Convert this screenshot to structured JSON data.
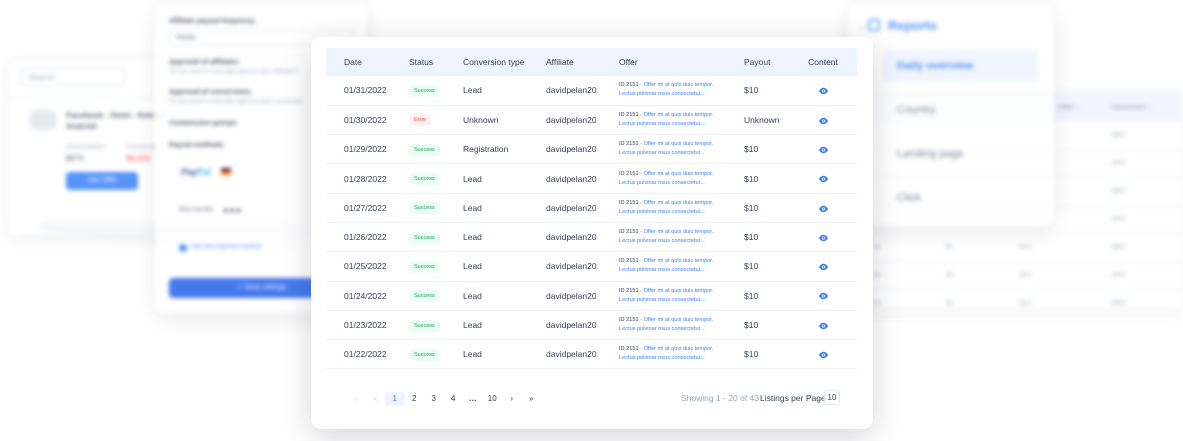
{
  "background": {
    "left_panel": {
      "search_placeholder": "Search",
      "item_title": "Facebook - Hotel - Keto at Android",
      "label_1": "Commission",
      "value_1": "$975",
      "label_2": "Conversion",
      "value_2": "$8,000",
      "button_label": "Join Offer"
    },
    "settings": {
      "payout_frequency_label": "Affiliate payout frequency",
      "payout_frequency_value": "Weekly",
      "approval_affiliates_label": "Approval of affiliates",
      "approval_affiliates_sub": "Do you want to manually approve new affiliates?",
      "approval_conversions_label": "Approval of conversions",
      "approval_conversions_sub": "Do you want to manually approve each conversion",
      "commission_groups_label": "Commission groups",
      "payout_methods_label": "Payout methods",
      "paypal_label_1": "Pay",
      "paypal_label_2": "Pal",
      "wire_label": "Wire transfer",
      "wire_dots": "●●●",
      "add_payment_label": "Add new payment method",
      "save_button": "✓ Save settings"
    },
    "right_table": {
      "headers": [
        "Clicks ⌄",
        "Conversions ⌄"
      ],
      "rows": [
        [
          "",
          "",
          "",
          "$000"
        ],
        [
          "",
          "",
          "",
          "$000"
        ],
        [
          "",
          "",
          "",
          "$000"
        ],
        [
          "",
          "",
          "",
          "$000"
        ],
        [
          "0%",
          "$0",
          "$0.0",
          "$000"
        ],
        [
          "0%",
          "$0",
          "$0.0",
          "$000"
        ],
        [
          "0%",
          "$0",
          "$0.0",
          "$000"
        ]
      ]
    },
    "reports": {
      "title": "Reports",
      "items": [
        {
          "label": "Daily overview",
          "active": true
        },
        {
          "label": "Country",
          "active": false
        },
        {
          "label": "Landing page",
          "active": false
        },
        {
          "label": "Click",
          "active": false
        }
      ]
    }
  },
  "table": {
    "columns": [
      "Date",
      "Status",
      "Conversion type",
      "Affiliate",
      "Offer",
      "Payout",
      "Content"
    ],
    "rows": [
      {
        "date": "01/31/2022",
        "status": "Success",
        "status_kind": "ok",
        "type": "Lead",
        "affiliate": "davidpelan20",
        "offer_id": "ID 2151",
        "offer_line1": " - Offer mi at quis duis tempor.",
        "offer_line2": "Lectus pulvinar risus consectetur...",
        "payout": "$10"
      },
      {
        "date": "01/30/2022",
        "status": "Error",
        "status_kind": "err",
        "type": "Unknown",
        "affiliate": "davidpelan20",
        "offer_id": "ID 2151",
        "offer_line1": " - Offer mi at quis duis tempor.",
        "offer_line2": "Lectus pulvinar risus consectetur...",
        "payout": "Unknown"
      },
      {
        "date": "01/29/2022",
        "status": "Success",
        "status_kind": "ok",
        "type": "Registration",
        "affiliate": "davidpelan20",
        "offer_id": "ID 2151",
        "offer_line1": " - Offer mi at quis duis tempor.",
        "offer_line2": "Lectus pulvinar risus consectetur...",
        "payout": "$10"
      },
      {
        "date": "01/28/2022",
        "status": "Success",
        "status_kind": "ok",
        "type": "Lead",
        "affiliate": "davidpelan20",
        "offer_id": "ID 2151",
        "offer_line1": " - Offer mi at quis duis tempor.",
        "offer_line2": "Lectus pulvinar risus consectetur...",
        "payout": "$10"
      },
      {
        "date": "01/27/2022",
        "status": "Success",
        "status_kind": "ok",
        "type": "Lead",
        "affiliate": "davidpelan20",
        "offer_id": "ID 2151",
        "offer_line1": " - Offer mi at quis duis tempor.",
        "offer_line2": "Lectus pulvinar risus consectetur...",
        "payout": "$10"
      },
      {
        "date": "01/26/2022",
        "status": "Success",
        "status_kind": "ok",
        "type": "Lead",
        "affiliate": "davidpelan20",
        "offer_id": "ID 2151",
        "offer_line1": " - Offer mi at quis duis tempor.",
        "offer_line2": "Lectus pulvinar risus consectetur...",
        "payout": "$10"
      },
      {
        "date": "01/25/2022",
        "status": "Success",
        "status_kind": "ok",
        "type": "Lead",
        "affiliate": "davidpelan20",
        "offer_id": "ID 2151",
        "offer_line1": " - Offer mi at quis duis tempor.",
        "offer_line2": "Lectus pulvinar risus consectetur...",
        "payout": "$10"
      },
      {
        "date": "01/24/2022",
        "status": "Success",
        "status_kind": "ok",
        "type": "Lead",
        "affiliate": "davidpelan20",
        "offer_id": "ID 2151",
        "offer_line1": " - Offer mi at quis duis tempor.",
        "offer_line2": "Lectus pulvinar risus consectetur...",
        "payout": "$10"
      },
      {
        "date": "01/23/2022",
        "status": "Success",
        "status_kind": "ok",
        "type": "Lead",
        "affiliate": "davidpelan20",
        "offer_id": "ID 2151",
        "offer_line1": " - Offer mi at quis duis tempor.",
        "offer_line2": "Lectus pulvinar risus consectetur...",
        "payout": "$10"
      },
      {
        "date": "01/22/2022",
        "status": "Success",
        "status_kind": "ok",
        "type": "Lead",
        "affiliate": "davidpelan20",
        "offer_id": "ID 2151",
        "offer_line1": " - Offer mi at quis duis tempor.",
        "offer_line2": "Lectus pulvinar risus consectetur...",
        "payout": "$10"
      }
    ],
    "content_icon": "eye-icon"
  },
  "pagination": {
    "first": "«",
    "prev": "‹",
    "pages": [
      "1",
      "2",
      "3",
      "4"
    ],
    "ellipsis": "…",
    "last_page": "10",
    "next": "›",
    "last": "»",
    "current": "1",
    "showing_text": "Showing 1 - 20 of 43",
    "listings_label": "Listings per Page",
    "listings_value": "10"
  },
  "colors": {
    "accent": "#3b82f6",
    "header_bg": "#eef4ff",
    "success": "#16a34a",
    "error": "#ef4444"
  }
}
